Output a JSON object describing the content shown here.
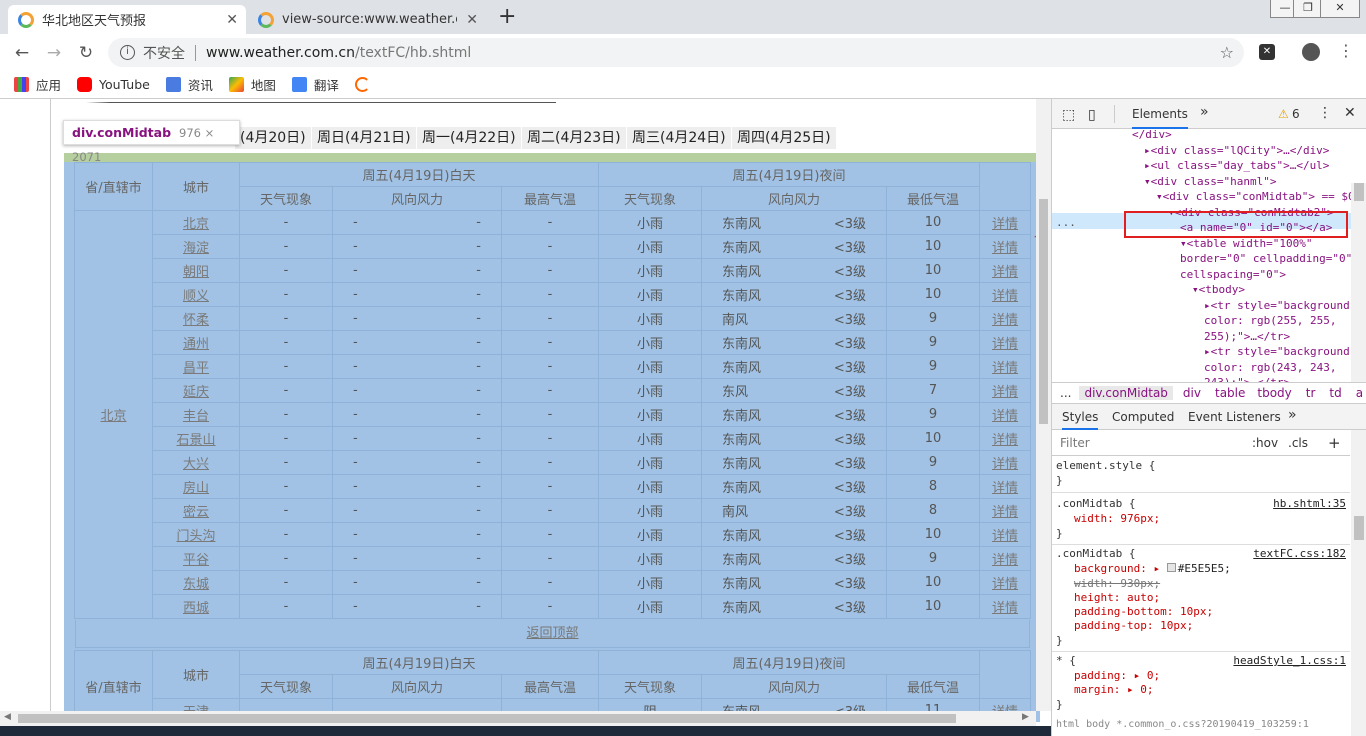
{
  "browser": {
    "tabs": [
      {
        "title": "华北地区天气预报",
        "active": true
      },
      {
        "title": "view-source:www.weather.com",
        "active": false
      }
    ],
    "new_tab": "+",
    "security": "不安全",
    "url_host": "www.weather.com.cn",
    "url_path": "/textFC/hb.shtml",
    "bookmarks": [
      "应用",
      "YouTube",
      "资讯",
      "地图",
      "翻译"
    ]
  },
  "page": {
    "day_tabs": [
      "(4月20日)",
      "周日(4月21日)",
      "周一(4月22日)",
      "周二(4月23日)",
      "周三(4月24日)",
      "周四(4月25日)"
    ],
    "tooltip": {
      "tag": "div.conMidtab",
      "size": "976 × 2071"
    },
    "table_header": {
      "province": "省/直辖市",
      "city": "城市",
      "day": "周五(4月19日)白天",
      "night": "周五(4月19日)夜间",
      "weather": "天气现象",
      "wind": "风向风力",
      "high": "最高气温",
      "low": "最低气温"
    },
    "province": "北京",
    "detail_label": "详情",
    "rows": [
      {
        "city": "北京",
        "day_w": "-",
        "day_dir": "-",
        "day_pow": "-",
        "high": "-",
        "night_w": "小雨",
        "night_dir": "东南风",
        "night_pow": "<3级",
        "low": "10"
      },
      {
        "city": "海淀",
        "day_w": "-",
        "day_dir": "-",
        "day_pow": "-",
        "high": "-",
        "night_w": "小雨",
        "night_dir": "东南风",
        "night_pow": "<3级",
        "low": "10"
      },
      {
        "city": "朝阳",
        "day_w": "-",
        "day_dir": "-",
        "day_pow": "-",
        "high": "-",
        "night_w": "小雨",
        "night_dir": "东南风",
        "night_pow": "<3级",
        "low": "10"
      },
      {
        "city": "顺义",
        "day_w": "-",
        "day_dir": "-",
        "day_pow": "-",
        "high": "-",
        "night_w": "小雨",
        "night_dir": "东南风",
        "night_pow": "<3级",
        "low": "10"
      },
      {
        "city": "怀柔",
        "day_w": "-",
        "day_dir": "-",
        "day_pow": "-",
        "high": "-",
        "night_w": "小雨",
        "night_dir": "南风",
        "night_pow": "<3级",
        "low": "9"
      },
      {
        "city": "通州",
        "day_w": "-",
        "day_dir": "-",
        "day_pow": "-",
        "high": "-",
        "night_w": "小雨",
        "night_dir": "东南风",
        "night_pow": "<3级",
        "low": "9"
      },
      {
        "city": "昌平",
        "day_w": "-",
        "day_dir": "-",
        "day_pow": "-",
        "high": "-",
        "night_w": "小雨",
        "night_dir": "东南风",
        "night_pow": "<3级",
        "low": "9"
      },
      {
        "city": "延庆",
        "day_w": "-",
        "day_dir": "-",
        "day_pow": "-",
        "high": "-",
        "night_w": "小雨",
        "night_dir": "东风",
        "night_pow": "<3级",
        "low": "7"
      },
      {
        "city": "丰台",
        "day_w": "-",
        "day_dir": "-",
        "day_pow": "-",
        "high": "-",
        "night_w": "小雨",
        "night_dir": "东南风",
        "night_pow": "<3级",
        "low": "9"
      },
      {
        "city": "石景山",
        "day_w": "-",
        "day_dir": "-",
        "day_pow": "-",
        "high": "-",
        "night_w": "小雨",
        "night_dir": "东南风",
        "night_pow": "<3级",
        "low": "10"
      },
      {
        "city": "大兴",
        "day_w": "-",
        "day_dir": "-",
        "day_pow": "-",
        "high": "-",
        "night_w": "小雨",
        "night_dir": "东南风",
        "night_pow": "<3级",
        "low": "9"
      },
      {
        "city": "房山",
        "day_w": "-",
        "day_dir": "-",
        "day_pow": "-",
        "high": "-",
        "night_w": "小雨",
        "night_dir": "东南风",
        "night_pow": "<3级",
        "low": "8"
      },
      {
        "city": "密云",
        "day_w": "-",
        "day_dir": "-",
        "day_pow": "-",
        "high": "-",
        "night_w": "小雨",
        "night_dir": "南风",
        "night_pow": "<3级",
        "low": "8"
      },
      {
        "city": "门头沟",
        "day_w": "-",
        "day_dir": "-",
        "day_pow": "-",
        "high": "-",
        "night_w": "小雨",
        "night_dir": "东南风",
        "night_pow": "<3级",
        "low": "10"
      },
      {
        "city": "平谷",
        "day_w": "-",
        "day_dir": "-",
        "day_pow": "-",
        "high": "-",
        "night_w": "小雨",
        "night_dir": "东南风",
        "night_pow": "<3级",
        "low": "9"
      },
      {
        "city": "东城",
        "day_w": "-",
        "day_dir": "-",
        "day_pow": "-",
        "high": "-",
        "night_w": "小雨",
        "night_dir": "东南风",
        "night_pow": "<3级",
        "low": "10"
      },
      {
        "city": "西城",
        "day_w": "-",
        "day_dir": "-",
        "day_pow": "-",
        "high": "-",
        "night_w": "小雨",
        "night_dir": "东南风",
        "night_pow": "<3级",
        "low": "10"
      }
    ],
    "back_to_top": "返回顶部",
    "next_row": {
      "city": "天津",
      "night_w": "阴",
      "night_dir": "东南风",
      "night_pow": "<3级",
      "low": "11"
    }
  },
  "devtools": {
    "tab_elements": "Elements",
    "more": "»",
    "warnings": "6",
    "dom_lines": [
      {
        "indent": 0,
        "text": "</div>"
      },
      {
        "indent": 1,
        "text": "▸<div class=\"lQCity\">…</div>"
      },
      {
        "indent": 1,
        "text": "▸<ul class=\"day_tabs\">…</ul>"
      },
      {
        "indent": 1,
        "text": "▾<div class=\"hanml\">"
      },
      {
        "indent": 2,
        "text": "▾<div class=\"conMidtab\"> == $0"
      },
      {
        "indent": 3,
        "text": "▾<div class=\"conMidtab2\">"
      },
      {
        "indent": 4,
        "text": "<a name=\"0\" id=\"0\"></a>"
      },
      {
        "indent": 4,
        "text": "▾<table width=\"100%\""
      },
      {
        "indent": 4,
        "text": "border=\"0\" cellpadding=\"0\""
      },
      {
        "indent": 4,
        "text": "cellspacing=\"0\">"
      },
      {
        "indent": 5,
        "text": "▾<tbody>"
      },
      {
        "indent": 6,
        "text": "▸<tr style=\"background-"
      },
      {
        "indent": 6,
        "text": "color: rgb(255, 255,"
      },
      {
        "indent": 6,
        "text": "255);\">…</tr>"
      },
      {
        "indent": 6,
        "text": "▸<tr style=\"background-"
      },
      {
        "indent": 6,
        "text": "color: rgb(243, 243,"
      },
      {
        "indent": 6,
        "text": "243);\">…</tr>"
      }
    ],
    "ellipsis": "...",
    "breadcrumbs": [
      "...",
      "div.conMidtab",
      "div",
      "table",
      "tbody",
      "tr",
      "td",
      "a"
    ],
    "styles_tabs": [
      "Styles",
      "Computed",
      "Event Listeners",
      "»"
    ],
    "filter_placeholder": "Filter",
    "hov": ":hov",
    "cls": ".cls",
    "plus": "+",
    "rules": [
      {
        "selector": "element.style {",
        "source": ""
      },
      {
        "selector": ".conMidtab {",
        "source": "hb.shtml:35"
      },
      {
        "selector": ".conMidtab {",
        "source": "textFC.css:182"
      },
      {
        "selector": "* {",
        "source": "headStyle_1.css:1"
      }
    ],
    "decls": {
      "width976": "width: 976px;",
      "bg": "background: ▸ ",
      "bgval": "#E5E5E5;",
      "width930": "width: 930px;",
      "height": "height: auto;",
      "pb": "padding-bottom: 10px;",
      "pt": "padding-top: 10px;",
      "padding": "padding: ▸ 0;",
      "margin": "margin: ▸ 0;",
      "close": "}"
    },
    "bottom_crumbs": "html  body  *.common_o.css?20190419_103259:1"
  }
}
